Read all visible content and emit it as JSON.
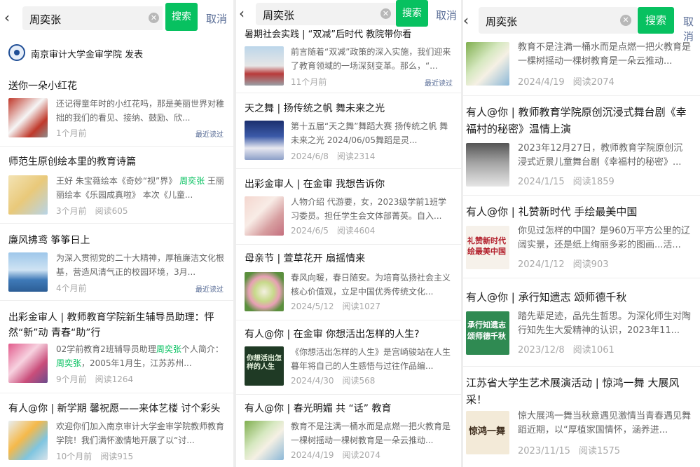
{
  "search": {
    "query": "周奕张",
    "button": "搜索",
    "cancel": "取消"
  },
  "recent_label": "最近读过",
  "panel1": {
    "publisher": "南京审计大学金审学院 发表",
    "articles": [
      {
        "title": "送你一朵小红花",
        "summary": "还记得童年时的小红花吗，那是美丽世界对稚拙的我们的看见、接纳、鼓励、欣...",
        "date": "1个月前",
        "reads": ""
      },
      {
        "title": "师范生原创绘本里的教育诗篇",
        "summary_a": "王好 朱宝薇绘本《奇妙“视”界》",
        "summary_hl": "周奕张",
        "summary_b": "王丽丽绘本《乐园成真啦》 本次《儿童...",
        "date": "3个月前",
        "reads": "阅读605"
      },
      {
        "title": "廉风拂鸢 筝筝日上",
        "summary": "为深入贯彻党的二十大精神，厚植廉洁文化根基，营造风清气正的校园环境，3月...",
        "date": "4个月前",
        "reads": ""
      },
      {
        "title": "出彩金审人 | 教师教育学院新生辅导员助理：怦然“新”动 青春“助”行",
        "summary_a": "02学前教育2班辅导员助理",
        "summary_hl": "周奕张",
        "summary_b": "个人简介：",
        "summary_hl2": "周奕张",
        "summary_c": "，2005年1月生，江苏苏州...",
        "date": "9个月前",
        "reads": "阅读1264"
      },
      {
        "title": "有人@你 | 新学期 馨祝愿——来体艺楼 讨个彩头",
        "summary": "欢迎你们加入南京审计大学金审学院教师教育学院！我们满怀激情地开展了以“讨...",
        "date": "10个月前",
        "reads": "阅读915"
      }
    ]
  },
  "panel2": {
    "articles": [
      {
        "title": "暑期社会实践 | “双减”后时代 教院带你看",
        "summary": "前言随着“双减”政策的深入实施，我们迎来了教育领域的一场深刻变革。那么，“...",
        "date": "11个月前",
        "reads": ""
      },
      {
        "title": "天之舞 | 扬传统之帆 舞未来之光",
        "summary": "第十五届“天之舞”舞蹈大赛 扬传统之帆 舞未来之光 2024/06/05舞蹈是灵...",
        "date": "2024/6/8",
        "reads": "阅读2314"
      },
      {
        "title": "出彩金审人 | 在金审 我想告诉你",
        "summary": "人物介绍 代游要，女，2023级学前1班学习委员。担任学生会文体部菁英。自入...",
        "date": "2024/6/5",
        "reads": "阅读4604"
      },
      {
        "title": "母亲节 | 萱草花开 扇摇情来",
        "summary": "春风向暖，春日随安。为培育弘扬社会主义核心价值观，立足中国优秀传统文化...",
        "date": "2024/5/12",
        "reads": "阅读1027"
      },
      {
        "title": "有人@你 | 在金审 你想活出怎样的人生?",
        "summary": "《你想活出怎样的人生》是宫崎骏站在人生暮年将自己的人生感悟与过往作品编...",
        "date": "2024/4/30",
        "reads": "阅读568",
        "img_text": "你想活出怎样的人生"
      },
      {
        "title": "有人@你 | 春光明媚 共 “话” 教育",
        "summary": "教育不是注满一桶水而是点燃一把火教育是一棵树摇动一棵树教育是一朵云推动...",
        "date": "2024/4/19",
        "reads": "阅读2074"
      }
    ]
  },
  "panel3": {
    "articles": [
      {
        "title": "",
        "summary": "教育不是注满一桶水而是点燃一把火教育是一棵树摇动一棵树教育是一朵云推动...",
        "date": "2024/4/19",
        "reads": "阅读2074"
      },
      {
        "title": "有人@你 | 教师教育学院原创沉浸式舞台剧《幸福村的秘密》温情上演",
        "summary": "2023年12月27日，教师教育学院原创沉浸式近景儿童舞台剧《幸福村的秘密》...",
        "date": "2024/1/15",
        "reads": "阅读1859"
      },
      {
        "title": "有人@你 | 礼赞新时代 手绘最美中国",
        "summary": "你见过怎样的中国？是960万平方公里的辽阔实景，还是纸上绚丽多彩的图画...活...",
        "date": "2024/1/12",
        "reads": "阅读903",
        "img_text": "礼赞新时代 绘最美中国"
      },
      {
        "title": "有人@你 | 承行知遗志 颂师德千秋",
        "summary": "踏先辈足迹，品先生哲思。为深化师生对陶行知先生大爱精神的认识，2023年11...",
        "date": "2023/12/8",
        "reads": "阅读1061",
        "img_text": "承行知遗志 颂师德千秋"
      },
      {
        "title": "江苏省大学生艺术展演活动 | 惊鸿一舞 大展风采！",
        "summary": "惊大展鸿一舞当秋意遇见激情当青春遇见舞蹈近期，以“厚植家国情怀，涵养进...",
        "date": "2023/11/15",
        "reads": "阅读1575",
        "img_text": "惊鸿一舞"
      }
    ]
  }
}
